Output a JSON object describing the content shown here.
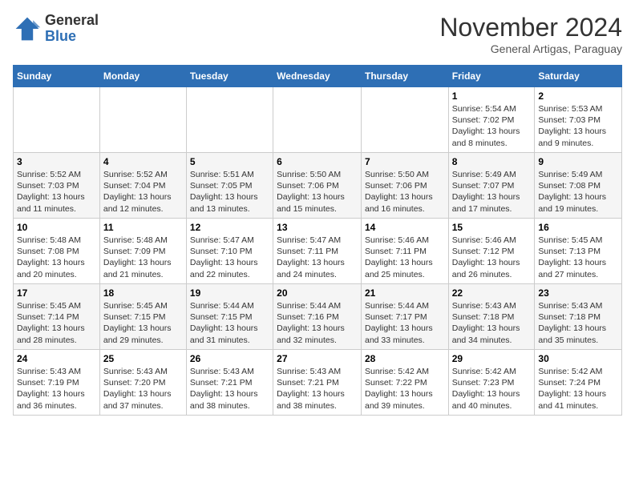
{
  "header": {
    "logo_general": "General",
    "logo_blue": "Blue",
    "month_title": "November 2024",
    "subtitle": "General Artigas, Paraguay"
  },
  "days_of_week": [
    "Sunday",
    "Monday",
    "Tuesday",
    "Wednesday",
    "Thursday",
    "Friday",
    "Saturday"
  ],
  "weeks": [
    [
      {
        "day": "",
        "info": ""
      },
      {
        "day": "",
        "info": ""
      },
      {
        "day": "",
        "info": ""
      },
      {
        "day": "",
        "info": ""
      },
      {
        "day": "",
        "info": ""
      },
      {
        "day": "1",
        "info": "Sunrise: 5:54 AM\nSunset: 7:02 PM\nDaylight: 13 hours\nand 8 minutes."
      },
      {
        "day": "2",
        "info": "Sunrise: 5:53 AM\nSunset: 7:03 PM\nDaylight: 13 hours\nand 9 minutes."
      }
    ],
    [
      {
        "day": "3",
        "info": "Sunrise: 5:52 AM\nSunset: 7:03 PM\nDaylight: 13 hours\nand 11 minutes."
      },
      {
        "day": "4",
        "info": "Sunrise: 5:52 AM\nSunset: 7:04 PM\nDaylight: 13 hours\nand 12 minutes."
      },
      {
        "day": "5",
        "info": "Sunrise: 5:51 AM\nSunset: 7:05 PM\nDaylight: 13 hours\nand 13 minutes."
      },
      {
        "day": "6",
        "info": "Sunrise: 5:50 AM\nSunset: 7:06 PM\nDaylight: 13 hours\nand 15 minutes."
      },
      {
        "day": "7",
        "info": "Sunrise: 5:50 AM\nSunset: 7:06 PM\nDaylight: 13 hours\nand 16 minutes."
      },
      {
        "day": "8",
        "info": "Sunrise: 5:49 AM\nSunset: 7:07 PM\nDaylight: 13 hours\nand 17 minutes."
      },
      {
        "day": "9",
        "info": "Sunrise: 5:49 AM\nSunset: 7:08 PM\nDaylight: 13 hours\nand 19 minutes."
      }
    ],
    [
      {
        "day": "10",
        "info": "Sunrise: 5:48 AM\nSunset: 7:08 PM\nDaylight: 13 hours\nand 20 minutes."
      },
      {
        "day": "11",
        "info": "Sunrise: 5:48 AM\nSunset: 7:09 PM\nDaylight: 13 hours\nand 21 minutes."
      },
      {
        "day": "12",
        "info": "Sunrise: 5:47 AM\nSunset: 7:10 PM\nDaylight: 13 hours\nand 22 minutes."
      },
      {
        "day": "13",
        "info": "Sunrise: 5:47 AM\nSunset: 7:11 PM\nDaylight: 13 hours\nand 24 minutes."
      },
      {
        "day": "14",
        "info": "Sunrise: 5:46 AM\nSunset: 7:11 PM\nDaylight: 13 hours\nand 25 minutes."
      },
      {
        "day": "15",
        "info": "Sunrise: 5:46 AM\nSunset: 7:12 PM\nDaylight: 13 hours\nand 26 minutes."
      },
      {
        "day": "16",
        "info": "Sunrise: 5:45 AM\nSunset: 7:13 PM\nDaylight: 13 hours\nand 27 minutes."
      }
    ],
    [
      {
        "day": "17",
        "info": "Sunrise: 5:45 AM\nSunset: 7:14 PM\nDaylight: 13 hours\nand 28 minutes."
      },
      {
        "day": "18",
        "info": "Sunrise: 5:45 AM\nSunset: 7:15 PM\nDaylight: 13 hours\nand 29 minutes."
      },
      {
        "day": "19",
        "info": "Sunrise: 5:44 AM\nSunset: 7:15 PM\nDaylight: 13 hours\nand 31 minutes."
      },
      {
        "day": "20",
        "info": "Sunrise: 5:44 AM\nSunset: 7:16 PM\nDaylight: 13 hours\nand 32 minutes."
      },
      {
        "day": "21",
        "info": "Sunrise: 5:44 AM\nSunset: 7:17 PM\nDaylight: 13 hours\nand 33 minutes."
      },
      {
        "day": "22",
        "info": "Sunrise: 5:43 AM\nSunset: 7:18 PM\nDaylight: 13 hours\nand 34 minutes."
      },
      {
        "day": "23",
        "info": "Sunrise: 5:43 AM\nSunset: 7:18 PM\nDaylight: 13 hours\nand 35 minutes."
      }
    ],
    [
      {
        "day": "24",
        "info": "Sunrise: 5:43 AM\nSunset: 7:19 PM\nDaylight: 13 hours\nand 36 minutes."
      },
      {
        "day": "25",
        "info": "Sunrise: 5:43 AM\nSunset: 7:20 PM\nDaylight: 13 hours\nand 37 minutes."
      },
      {
        "day": "26",
        "info": "Sunrise: 5:43 AM\nSunset: 7:21 PM\nDaylight: 13 hours\nand 38 minutes."
      },
      {
        "day": "27",
        "info": "Sunrise: 5:43 AM\nSunset: 7:21 PM\nDaylight: 13 hours\nand 38 minutes."
      },
      {
        "day": "28",
        "info": "Sunrise: 5:42 AM\nSunset: 7:22 PM\nDaylight: 13 hours\nand 39 minutes."
      },
      {
        "day": "29",
        "info": "Sunrise: 5:42 AM\nSunset: 7:23 PM\nDaylight: 13 hours\nand 40 minutes."
      },
      {
        "day": "30",
        "info": "Sunrise: 5:42 AM\nSunset: 7:24 PM\nDaylight: 13 hours\nand 41 minutes."
      }
    ]
  ]
}
